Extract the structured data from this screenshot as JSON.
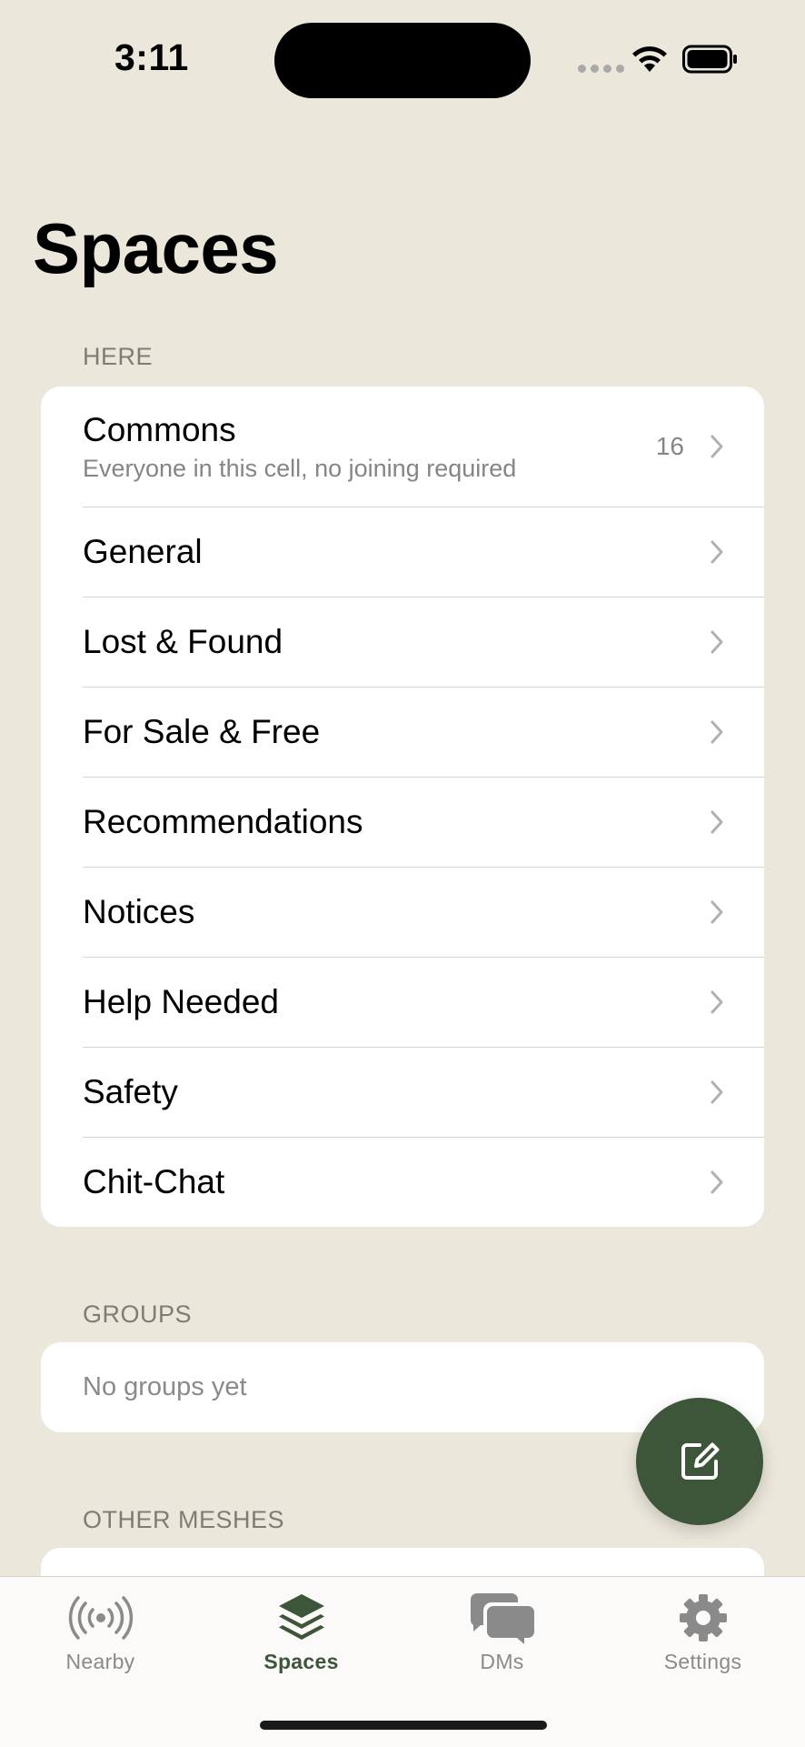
{
  "status_bar": {
    "time": "3:11"
  },
  "header": {
    "title": "Spaces"
  },
  "sections": {
    "here": {
      "title": "HERE",
      "commons": {
        "label": "Commons",
        "subtitle": "Everyone in this cell, no joining required",
        "count": "16"
      },
      "items": [
        {
          "label": "General"
        },
        {
          "label": "Lost & Found"
        },
        {
          "label": "For Sale & Free"
        },
        {
          "label": "Recommendations"
        },
        {
          "label": "Notices"
        },
        {
          "label": "Help Needed"
        },
        {
          "label": "Safety"
        },
        {
          "label": "Chit-Chat"
        }
      ]
    },
    "groups": {
      "title": "GROUPS",
      "empty": "No groups yet"
    },
    "other_meshes": {
      "title": "OTHER MESHES"
    }
  },
  "fab": {
    "icon": "compose-icon",
    "color": "#3d5538"
  },
  "tab_bar": {
    "active": "Spaces",
    "tabs": [
      {
        "label": "Nearby",
        "icon": "broadcast-icon"
      },
      {
        "label": "Spaces",
        "icon": "layers-icon"
      },
      {
        "label": "DMs",
        "icon": "chat-bubbles-icon"
      },
      {
        "label": "Settings",
        "icon": "gear-icon"
      }
    ]
  },
  "colors": {
    "background": "#ebe7db",
    "accent": "#3d5538",
    "card": "#ffffff"
  }
}
